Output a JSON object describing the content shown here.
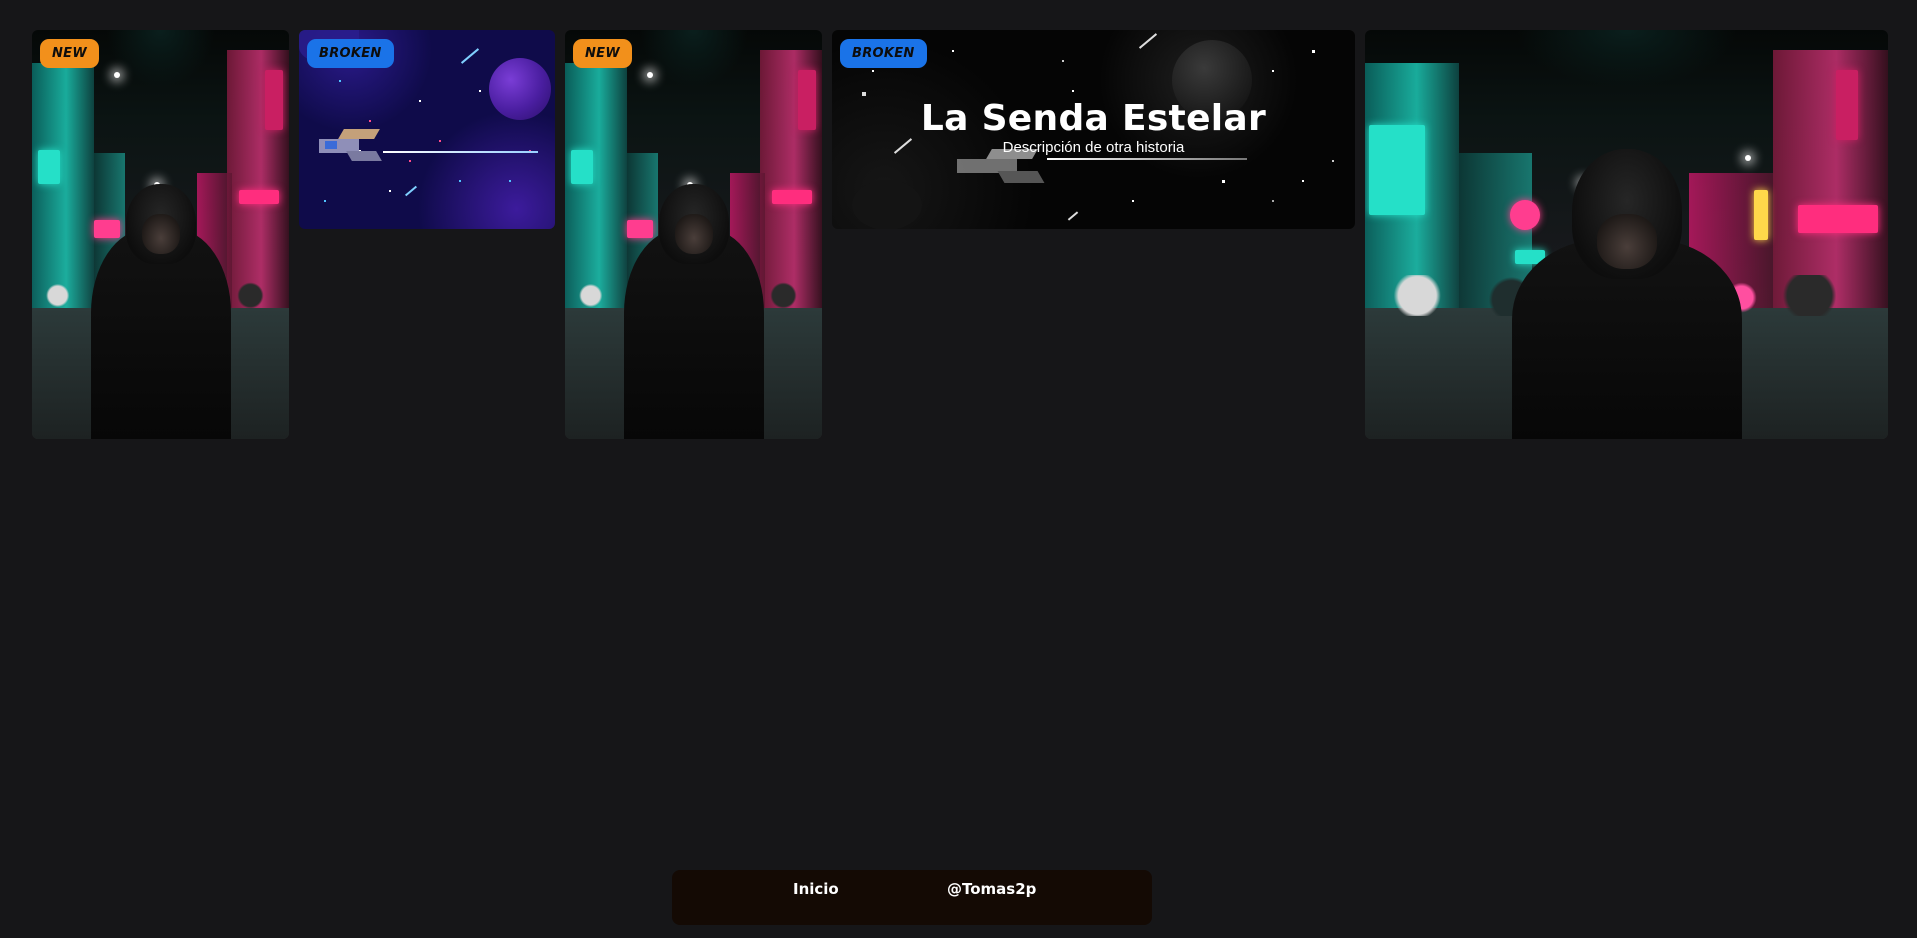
{
  "cards": [
    {
      "badge": "NEW",
      "badge_color": "#f2901b",
      "image": "neon-street-hooded-figure"
    },
    {
      "badge": "BROKEN",
      "badge_color": "#1a73e8",
      "image": "pixel-spaceship-blue"
    },
    {
      "badge": "NEW",
      "badge_color": "#f2901b",
      "image": "neon-street-hooded-figure"
    },
    {
      "badge": "BROKEN",
      "badge_color": "#1a73e8",
      "image": "pixel-spaceship-dark",
      "title": "La Senda Estelar",
      "description": "Descripción de otra historia"
    },
    {
      "image": "neon-street-hooded-figure"
    }
  ],
  "nav": {
    "home_label": "Inicio",
    "user_label": "@Tomas2p"
  },
  "colors": {
    "background": "#161618",
    "nav_background": "#140a04",
    "badge_new": "#f2901b",
    "badge_broken": "#1a73e8"
  }
}
